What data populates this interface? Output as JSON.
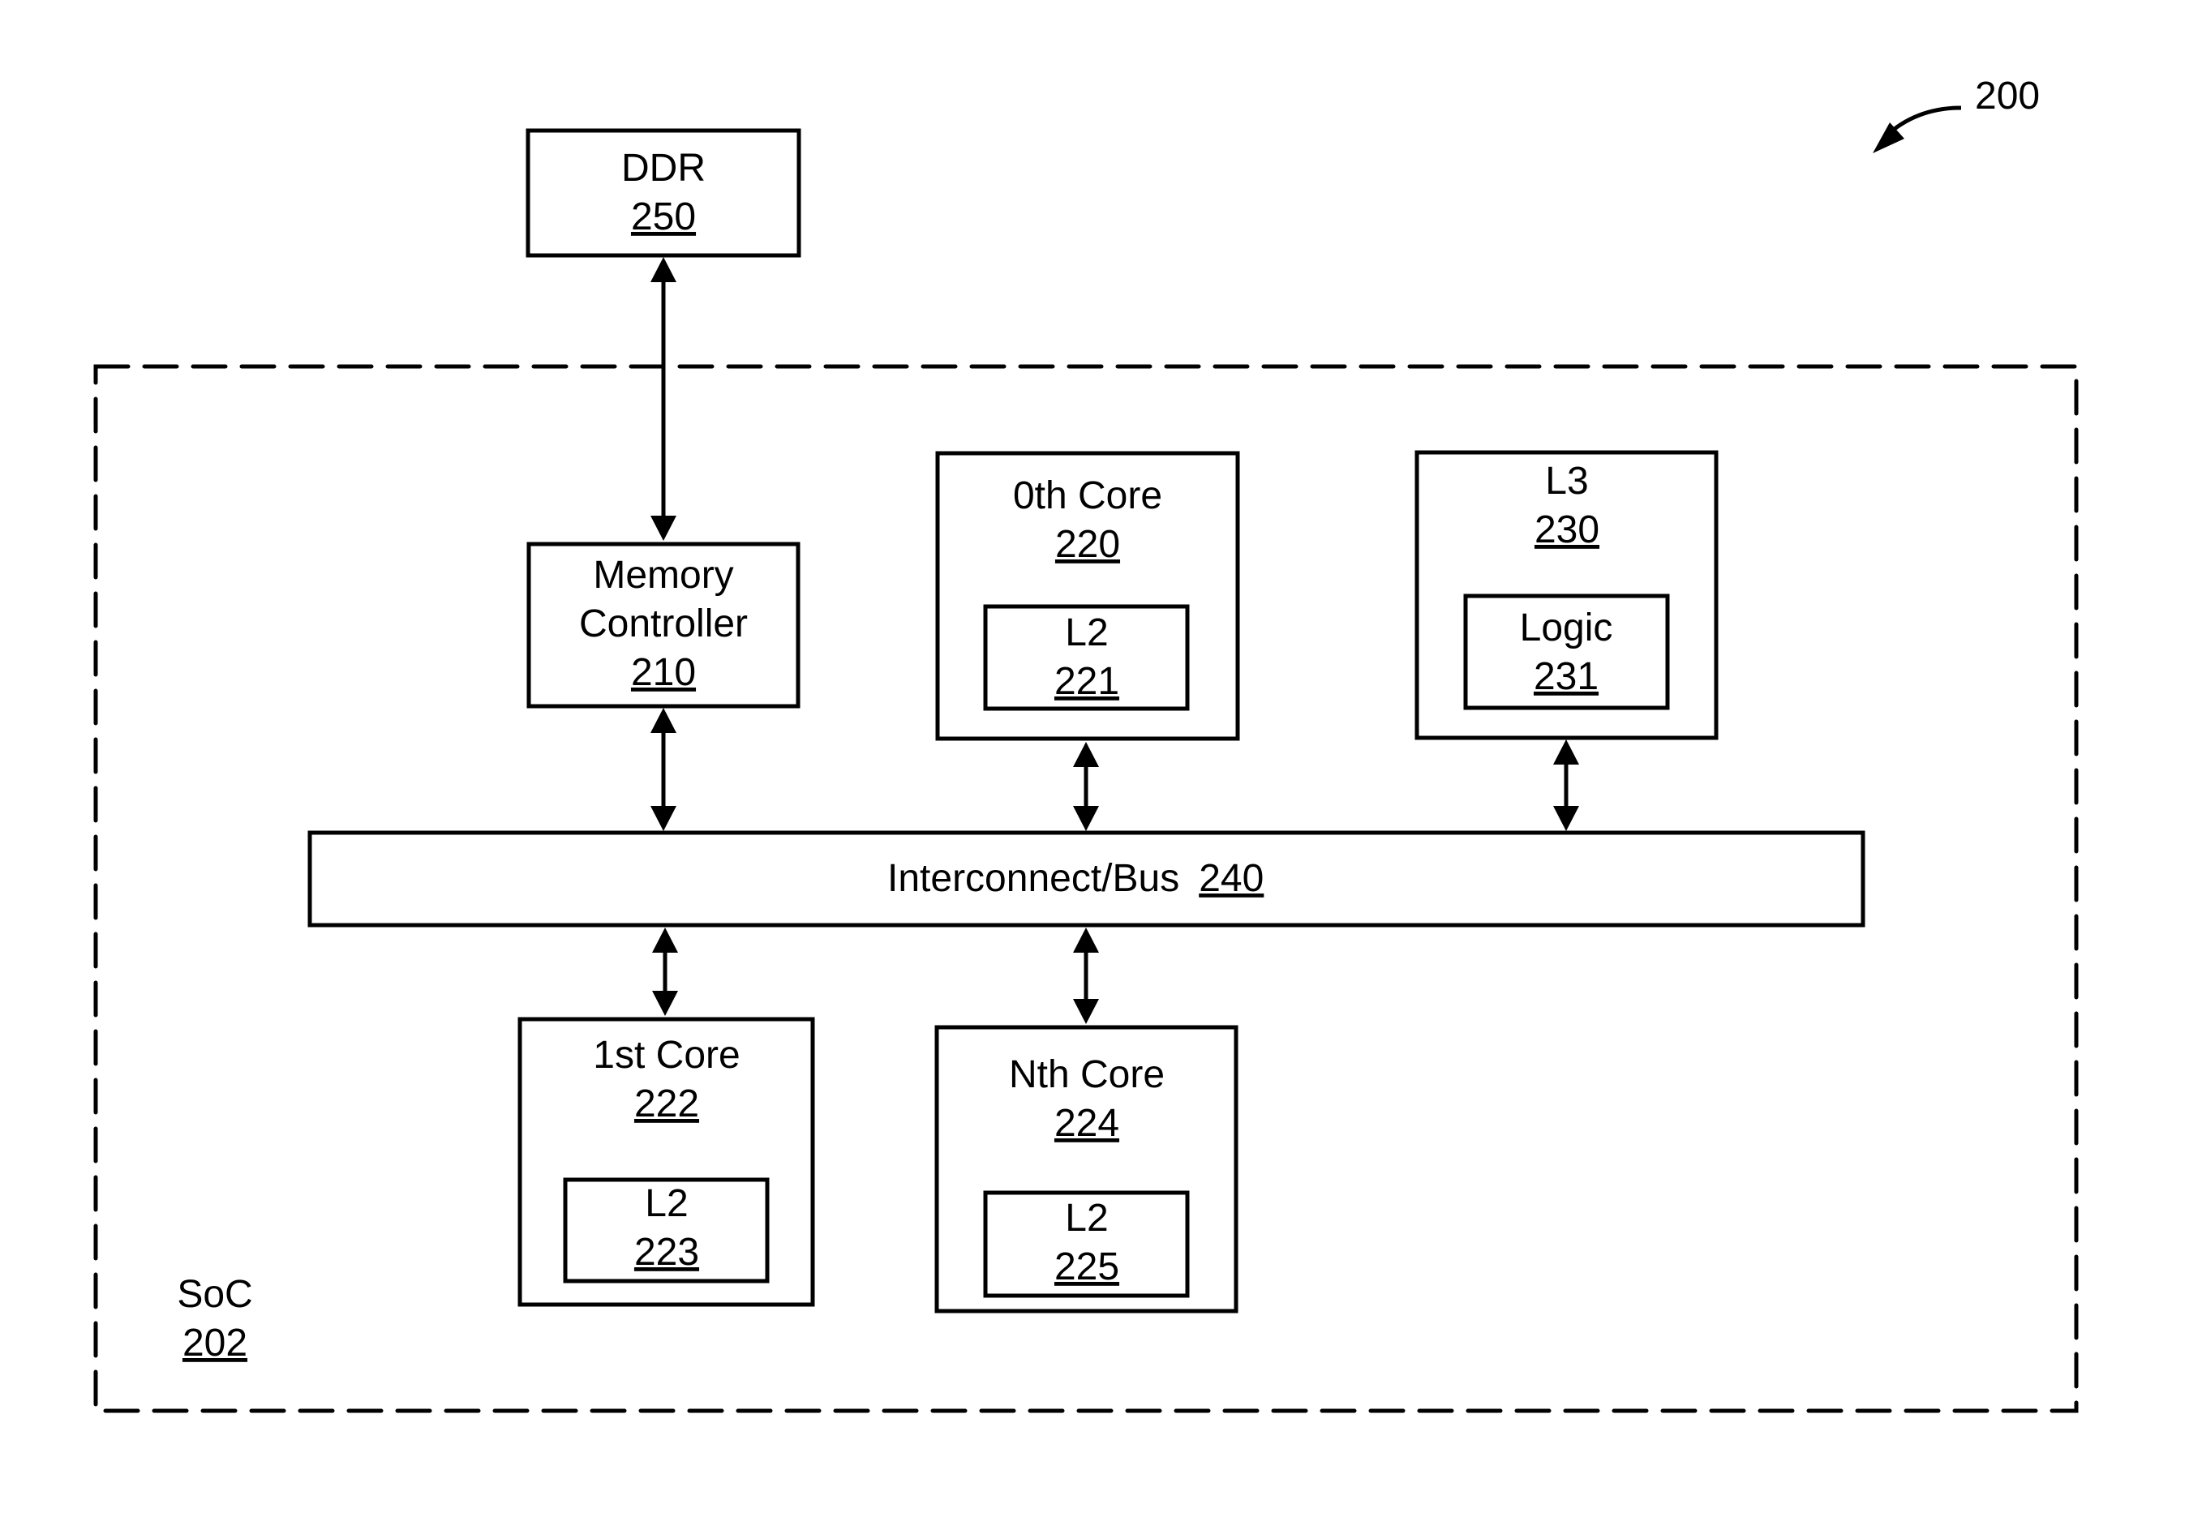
{
  "figure": {
    "ref": "200",
    "soc": {
      "name": "SoC",
      "ref": "202"
    },
    "ddr": {
      "name": "DDR",
      "ref": "250"
    },
    "memory_controller": {
      "name_line1": "Memory",
      "name_line2": "Controller",
      "ref": "210"
    },
    "core0": {
      "name": "0th Core",
      "ref": "220",
      "l2": {
        "name": "L2",
        "ref": "221"
      }
    },
    "l3": {
      "name": "L3",
      "ref": "230",
      "logic": {
        "name": "Logic",
        "ref": "231"
      }
    },
    "bus": {
      "name": "Interconnect/Bus",
      "ref": "240"
    },
    "core1": {
      "name": "1st Core",
      "ref": "222",
      "l2": {
        "name": "L2",
        "ref": "223"
      }
    },
    "coreN": {
      "name": "Nth Core",
      "ref": "224",
      "l2": {
        "name": "L2",
        "ref": "225"
      }
    }
  },
  "connections": [
    {
      "from": "DDR 250",
      "to": "Memory Controller 210",
      "direction": "bidirectional"
    },
    {
      "from": "Memory Controller 210",
      "to": "Interconnect/Bus 240",
      "direction": "bidirectional"
    },
    {
      "from": "0th Core 220",
      "to": "Interconnect/Bus 240",
      "direction": "bidirectional"
    },
    {
      "from": "L3 230",
      "to": "Interconnect/Bus 240",
      "direction": "bidirectional"
    },
    {
      "from": "1st Core 222",
      "to": "Interconnect/Bus 240",
      "direction": "bidirectional"
    },
    {
      "from": "Nth Core 224",
      "to": "Interconnect/Bus 240",
      "direction": "bidirectional"
    }
  ]
}
